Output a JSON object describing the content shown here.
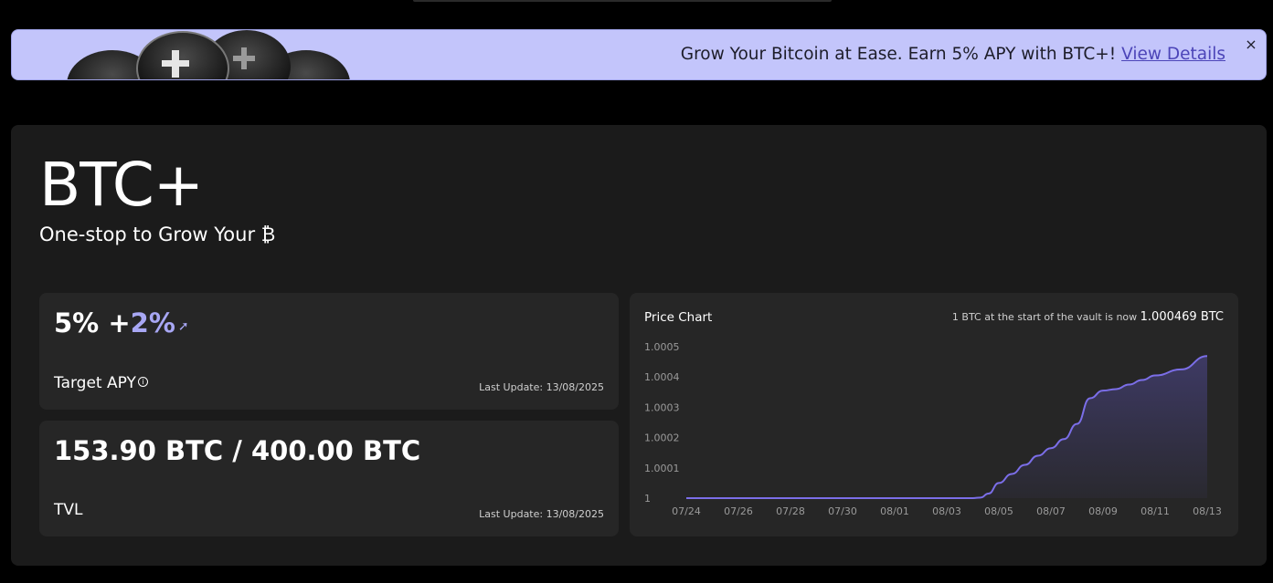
{
  "banner": {
    "text": "Grow Your Bitcoin at Ease. Earn 5% APY with BTC+!",
    "link": "View Details",
    "close": "×"
  },
  "hero": {
    "title": "BTC+",
    "subtitle": "One-stop to Grow Your ₿"
  },
  "apy_card": {
    "base": "5%",
    "plus": "+",
    "bonus": "2%",
    "rocket_icon": "rocket-icon",
    "label": "Target APY",
    "info_glyph": "i",
    "last_update": "Last Update: 13/08/2025"
  },
  "tvl_card": {
    "value": "153.90 BTC / 400.00 BTC",
    "label": "TVL",
    "last_update": "Last Update: 13/08/2025"
  },
  "price_chart": {
    "title": "Price Chart",
    "note_prefix": "1 BTC at the start of the vault is now",
    "note_value": "1.000469 BTC"
  },
  "colors": {
    "banner_bg": "#c3c5fb",
    "accent": "#a8a7f4",
    "line": "#7b6ee8",
    "panel_bg": "#1b1b1b",
    "card_bg": "#262626"
  },
  "chart_data": {
    "type": "area",
    "title": "Price Chart",
    "xlabel": "",
    "ylabel": "",
    "x_ticks": [
      "07/24",
      "07/26",
      "07/28",
      "07/30",
      "08/01",
      "08/03",
      "08/05",
      "08/07",
      "08/09",
      "08/11",
      "08/13"
    ],
    "y_ticks": [
      "1",
      "1.0001",
      "1.0002",
      "1.0003",
      "1.0004",
      "1.0005"
    ],
    "ylim": [
      1,
      1.0005
    ],
    "grid": false,
    "series": [
      {
        "x": [
          0,
          1,
          2,
          3,
          4,
          5,
          6,
          7,
          8,
          9,
          10,
          11,
          11.3,
          11.6,
          12,
          12.5,
          13,
          13.5,
          14,
          14.5,
          15,
          15.5,
          16,
          16.5,
          17,
          17.5,
          18,
          19,
          20
        ],
        "y": [
          1,
          1,
          1,
          1,
          1,
          1,
          1,
          1,
          1,
          1,
          1,
          1,
          1.000002,
          1.000015,
          1.00005,
          1.00008,
          1.00011,
          1.00014,
          1.000165,
          1.000195,
          1.000245,
          1.00033,
          1.000355,
          1.00036,
          1.000375,
          1.00039,
          1.000405,
          1.000425,
          1.000469
        ]
      }
    ]
  }
}
